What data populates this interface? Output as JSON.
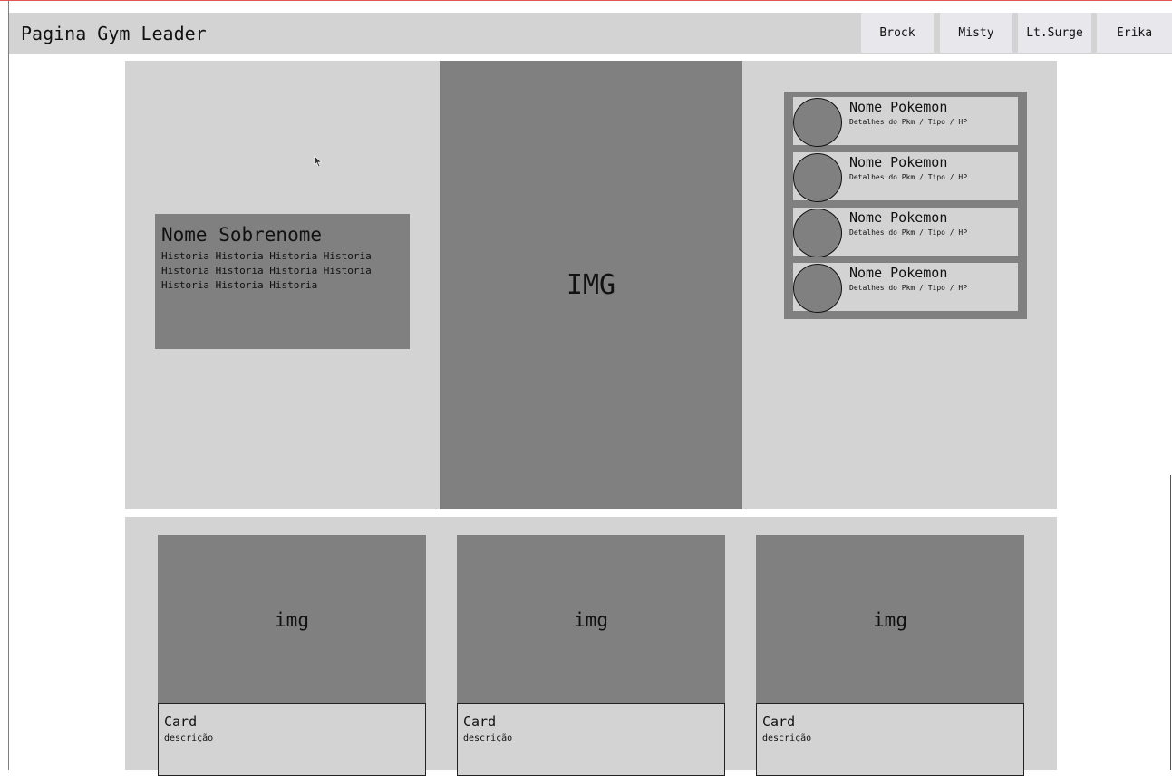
{
  "navbar": {
    "title": "Pagina Gym Leader",
    "links": [
      {
        "label": "Brock"
      },
      {
        "label": "Misty"
      },
      {
        "label": "Lt.Surge"
      },
      {
        "label": "Erika"
      }
    ]
  },
  "hero": {
    "bio": {
      "name": "Nome Sobrenome",
      "text": "Historia Historia Historia Historia Historia Historia Historia Historia Historia Historia Historia"
    },
    "image_label": "IMG",
    "party": [
      {
        "name": "Nome Pokemon",
        "details": "Detalhes do Pkm / Tipo / HP"
      },
      {
        "name": "Nome Pokemon",
        "details": "Detalhes do Pkm / Tipo / HP"
      },
      {
        "name": "Nome Pokemon",
        "details": "Detalhes do Pkm / Tipo / HP"
      },
      {
        "name": "Nome Pokemon",
        "details": "Detalhes do Pkm / Tipo / HP"
      }
    ]
  },
  "cards": [
    {
      "image_label": "img",
      "title": "Card",
      "description": "descrição"
    },
    {
      "image_label": "img",
      "title": "Card",
      "description": "descrição"
    },
    {
      "image_label": "img",
      "title": "Card",
      "description": "descrição"
    }
  ],
  "colors": {
    "panel": "#d3d3d3",
    "placeholder": "#808080",
    "nav_button": "#e8e8ec",
    "frame_border": "#e05555"
  }
}
